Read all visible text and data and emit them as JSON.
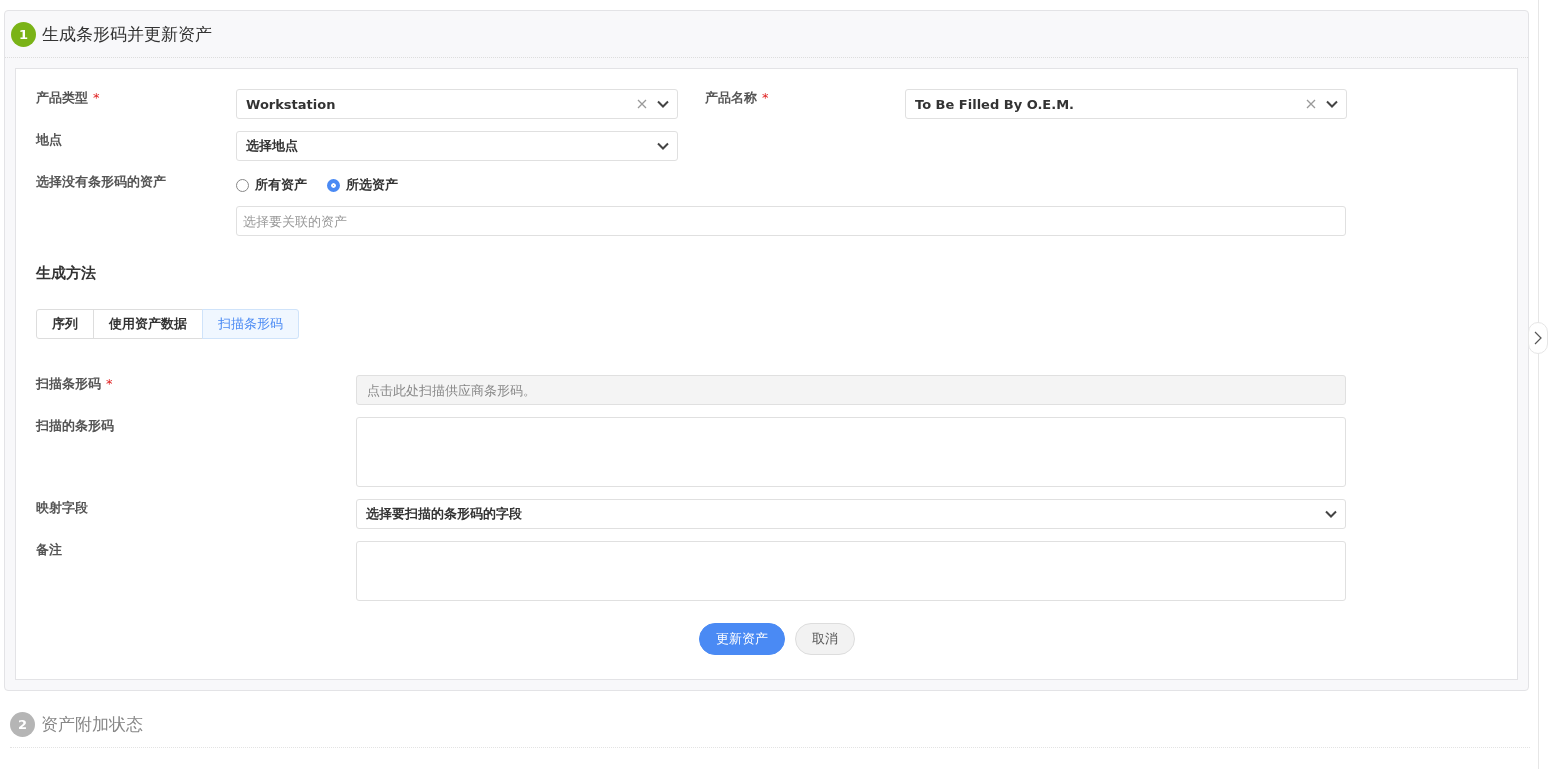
{
  "step1": {
    "number": "1",
    "title": "生成条形码并更新资产",
    "active": true
  },
  "product_type": {
    "label": "产品类型",
    "required_mark": "*",
    "value": "Workstation",
    "clearable": true
  },
  "product_name": {
    "label": "产品名称",
    "required_mark": "*",
    "value": "To Be Filled By O.E.M.",
    "clearable": true
  },
  "location": {
    "label": "地点",
    "value": "选择地点"
  },
  "asset_selection": {
    "label": "选择没有条形码的资产",
    "options": [
      {
        "label": "所有资产",
        "selected": false
      },
      {
        "label": "所选资产",
        "selected": true
      }
    ],
    "placeholder": "选择要关联的资产"
  },
  "method": {
    "title": "生成方法",
    "tabs": [
      {
        "label": "序列",
        "selected": false
      },
      {
        "label": "使用资产数据",
        "selected": false
      },
      {
        "label": "扫描条形码",
        "selected": true
      }
    ]
  },
  "scan_barcode": {
    "label": "扫描条形码",
    "required_mark": "*",
    "placeholder": "点击此处扫描供应商条形码。",
    "disabled": true
  },
  "scanned_barcodes": {
    "label": "扫描的条形码"
  },
  "mapping_field": {
    "label": "映射字段",
    "value": "选择要扫描的条形码的字段"
  },
  "notes": {
    "label": "备注"
  },
  "buttons": [
    {
      "label": "更新资产",
      "kind": "primary"
    },
    {
      "label": "取消",
      "kind": "secondary"
    }
  ],
  "step2": {
    "number": "2",
    "title": "资产附加状态",
    "active": false
  }
}
